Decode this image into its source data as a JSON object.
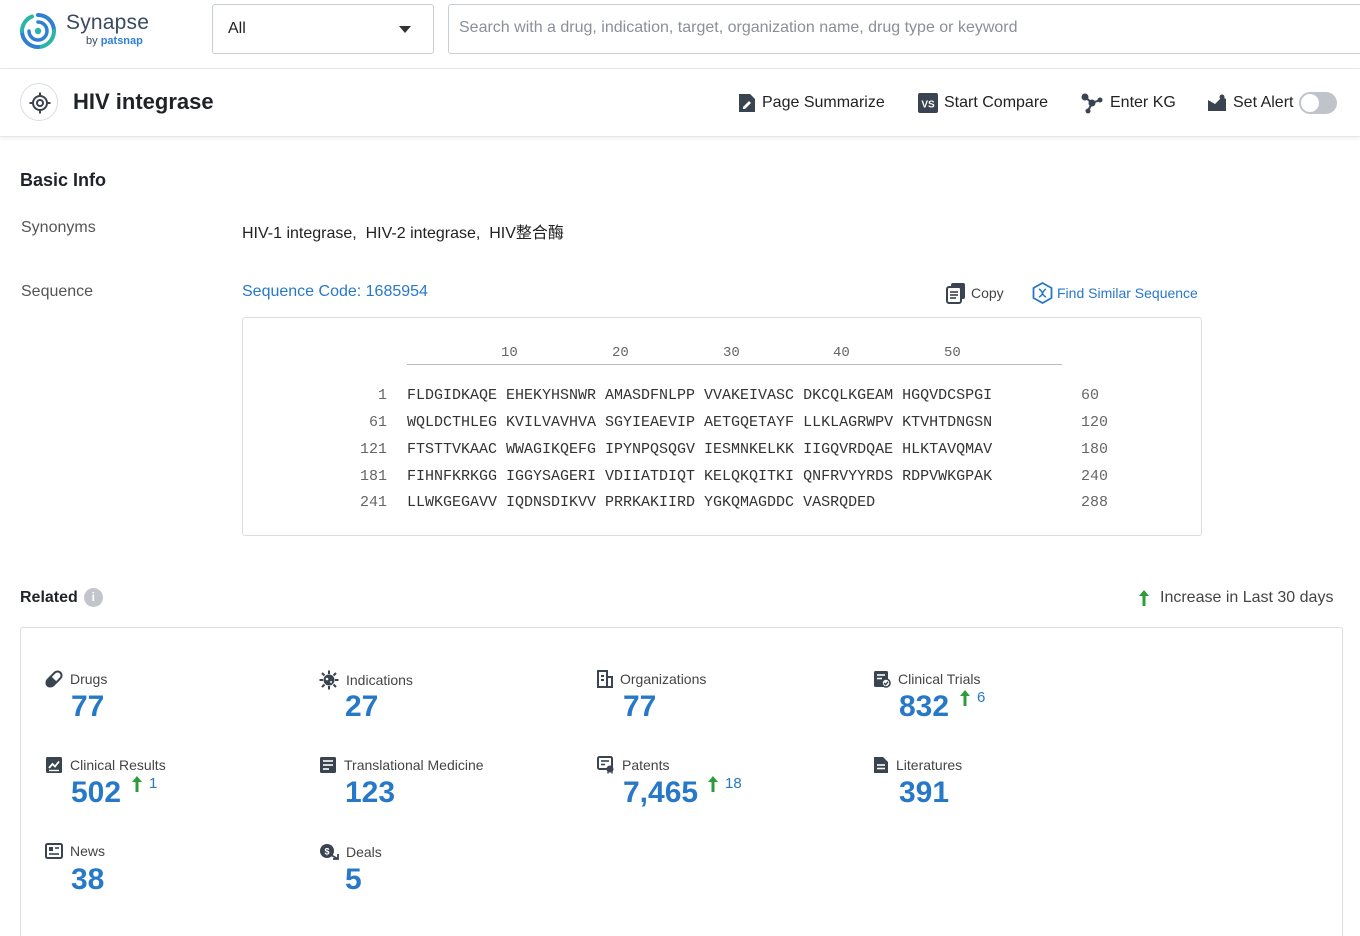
{
  "brand": {
    "name": "Synapse",
    "sub_prefix": "by",
    "sub_brand": "patsnap",
    "accent": "#2f7fd3"
  },
  "search": {
    "scope_value": "All",
    "placeholder": "Search with a drug, indication, target, organization name, drug type or keyword"
  },
  "header": {
    "title": "HIV integrase",
    "actions": {
      "summarize": "Page Summarize",
      "compare": "Start Compare",
      "kg": "Enter KG",
      "alert": "Set Alert"
    },
    "alert_enabled": false
  },
  "basic_info": {
    "title": "Basic Info",
    "synonyms_label": "Synonyms",
    "synonyms": "HIV-1 integrase,  HIV-2 integrase,  HIV整合酶",
    "sequence_label": "Sequence",
    "sequence_code": "Sequence Code: 1685954",
    "copy_label": "Copy",
    "find_similar_label": "Find Similar Sequence",
    "ruler_ticks": [
      "10",
      "20",
      "30",
      "40",
      "50"
    ],
    "rows": [
      {
        "start": "1",
        "seq": "FLDGIDKAQE EHEKYHSNWR AMASDFNLPP VVAKEIVASC DKCQLKGEAM HGQVDCSPGI",
        "end": "60"
      },
      {
        "start": "61",
        "seq": "WQLDCTHLEG KVILVAVHVA SGYIEAEVIP AETGQETAYF LLKLAGRWPV KTVHTDNGSN",
        "end": "120"
      },
      {
        "start": "121",
        "seq": "FTSTTVKAAC WWAGIKQEFG IPYNPQSQGV IESMNKELKK IIGQVRDQAE HLKTAVQMAV",
        "end": "180"
      },
      {
        "start": "181",
        "seq": "FIHNFKRKGG IGGYSAGERI VDIIATDIQT KELQKQITKI QNFRVYYRDS RDPVWKGPAK",
        "end": "240"
      },
      {
        "start": "241",
        "seq": "LLWKGEGAVV IQDNSDIKVV PRRKAKIIRD YGKQMAGDDC VASRQDED",
        "end": "288"
      }
    ]
  },
  "related": {
    "title": "Related",
    "info_icon": "info-icon",
    "legend": "Increase in Last 30 days",
    "increase_color": "#2e9c3a",
    "stats": [
      {
        "label": "Drugs",
        "value": "77",
        "increase": ""
      },
      {
        "label": "Indications",
        "value": "27",
        "increase": ""
      },
      {
        "label": "Organizations",
        "value": "77",
        "increase": ""
      },
      {
        "label": "Clinical Trials",
        "value": "832",
        "increase": "6"
      },
      {
        "label": "Clinical Results",
        "value": "502",
        "increase": "1"
      },
      {
        "label": "Translational Medicine",
        "value": "123",
        "increase": ""
      },
      {
        "label": "Patents",
        "value": "7,465",
        "increase": "18"
      },
      {
        "label": "Literatures",
        "value": "391",
        "increase": ""
      },
      {
        "label": "News",
        "value": "38",
        "increase": ""
      },
      {
        "label": "Deals",
        "value": "5",
        "increase": ""
      }
    ]
  }
}
